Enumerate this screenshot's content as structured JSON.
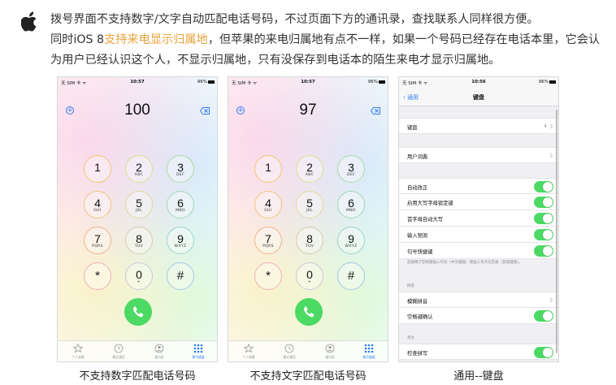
{
  "header": {
    "line1": "拨号界面不支持数字/文字自动匹配电话号码，不过页面下方的通讯录，查找联系人同样很方便。",
    "line2_pre": "同时iOS 8",
    "line2_highlight": "支持来电显示归属地",
    "line2_post": "，但苹果的来电归属地有点不一样，如果一个号码已经存在电话本里，它会认为用户已经认识这个人，不显示归属地，只有没保存到电话本的陌生来电才显示归属地。",
    "highlight_color": "#e8a23a"
  },
  "phones": [
    {
      "status": {
        "carrier": "无 SIM 卡 ᯤ",
        "time": "10:57",
        "battery": "96%"
      },
      "number": "100",
      "caption": "不支持数字匹配电话号码"
    },
    {
      "status": {
        "carrier": "无 SIM 卡 ᯤ",
        "time": "10:57",
        "battery": "96%"
      },
      "number": "97",
      "caption": "不支持文字匹配电话号码"
    },
    {
      "status": {
        "carrier": "无 SIM 卡 ᯤ",
        "time": "10:56",
        "battery": "96%"
      },
      "caption": "通用--键盘"
    }
  ],
  "keypad": {
    "k1": {
      "digit": "1",
      "letters": ""
    },
    "k2": {
      "digit": "2",
      "letters": "ABC"
    },
    "k3": {
      "digit": "3",
      "letters": "DEF"
    },
    "k4": {
      "digit": "4",
      "letters": "GHI"
    },
    "k5": {
      "digit": "5",
      "letters": "JKL"
    },
    "k6": {
      "digit": "6",
      "letters": "MNO"
    },
    "k7": {
      "digit": "7",
      "letters": "PQRS"
    },
    "k8": {
      "digit": "8",
      "letters": "TUV"
    },
    "k9": {
      "digit": "9",
      "letters": "WXYZ"
    },
    "kstar": {
      "digit": "*",
      "letters": ""
    },
    "k0": {
      "digit": "0",
      "letters": "+"
    },
    "khash": {
      "digit": "#",
      "letters": ""
    }
  },
  "tabs": {
    "favorites": "个人收藏",
    "recents": "最近通话",
    "contacts": "通讯录",
    "keypad": "拨号键盘"
  },
  "settings": {
    "back_label": "通用",
    "title": "键盘",
    "keyboards_label": "键盘",
    "keyboards_count": "4",
    "user_dictionary": "用户词典",
    "auto_correct": "自动改正",
    "caps_lock": "启用大写字母锁定键",
    "auto_capitalization": "首字母自动大写",
    "predictive": "输入预测",
    "period_shortcut": "句号快捷键",
    "period_note": "连按两下空格键插入句号（中文键盘）或插入句点与空格（其他键盘）。",
    "pinyin_header": "拼音",
    "fuzzy_pinyin": "模糊拼音",
    "space_confirm": "空格键确认",
    "english_header": "英文",
    "spell_check": "检查拼写",
    "toggle_color": "#4cd964"
  }
}
